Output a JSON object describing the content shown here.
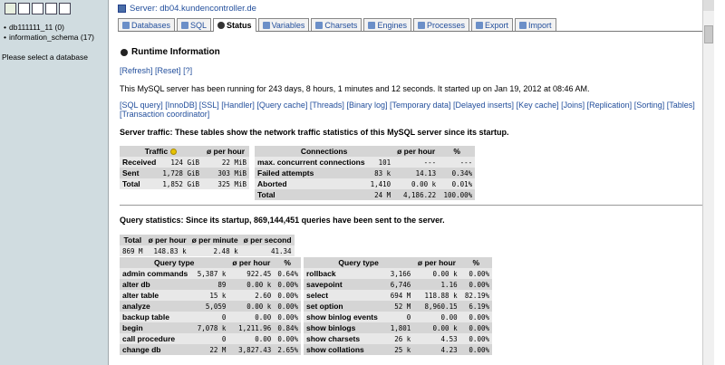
{
  "sidebar": {
    "databases": [
      "db111111_11 (0)",
      "information_schema (17)"
    ],
    "prompt": "Please select a database"
  },
  "header": {
    "server_label": "Server: db04.kundencontroller.de"
  },
  "tabs": [
    "Databases",
    "SQL",
    "Status",
    "Variables",
    "Charsets",
    "Engines",
    "Processes",
    "Export",
    "Import"
  ],
  "active_tab": "Status",
  "title": "Runtime Information",
  "top_links": {
    "refresh": "[Refresh]",
    "reset": "[Reset]",
    "help": "[?]"
  },
  "uptime": "This MySQL server has been running for 243 days, 8 hours, 1 minutes and 12 seconds. It started up on Jan 19, 2012 at 08:46 AM.",
  "sub_links": [
    "[SQL query]",
    "[InnoDB]",
    "[SSL]",
    "[Handler]",
    "[Query cache]",
    "[Threads]",
    "[Binary log]",
    "[Temporary data]",
    "[Delayed inserts]",
    "[Key cache]",
    "[Joins]",
    "[Replication]",
    "[Sorting]",
    "[Tables]",
    "[Transaction coordinator]"
  ],
  "traffic": {
    "heading": "Server traffic: These tables show the network traffic statistics of this MySQL server since its startup.",
    "headers": [
      "Traffic",
      "ø per hour"
    ],
    "rows": [
      [
        "Received",
        "124 GiB",
        "22 MiB"
      ],
      [
        "Sent",
        "1,728 GiB",
        "303 MiB"
      ],
      [
        "Total",
        "1,852 GiB",
        "325 MiB"
      ]
    ]
  },
  "connections": {
    "headers": [
      "Connections",
      "ø per hour",
      "%"
    ],
    "rows": [
      [
        "max. concurrent connections",
        "101",
        "---",
        "---"
      ],
      [
        "Failed attempts",
        "83 k",
        "14.13",
        "0.34%"
      ],
      [
        "Aborted",
        "1,410",
        "0.00 k",
        "0.01%"
      ],
      [
        "Total",
        "24 M",
        "4,186.22",
        "100.00%"
      ]
    ]
  },
  "query_stats": {
    "heading": "Query statistics: Since its startup, 869,144,451 queries have been sent to the server.",
    "headers": [
      "Total",
      "ø per hour",
      "ø per minute",
      "ø per second"
    ],
    "values": [
      "869 M",
      "148.83 k",
      "2.48 k",
      "41.34"
    ]
  },
  "query_left": {
    "headers": [
      "Query type",
      "ø per hour",
      "%"
    ],
    "rows": [
      [
        "admin commands",
        "5,387 k",
        "922.45",
        "0.64%"
      ],
      [
        "alter db",
        "89",
        "0.00 k",
        "0.00%"
      ],
      [
        "alter table",
        "15 k",
        "2.60",
        "0.00%"
      ],
      [
        "analyze",
        "5,059",
        "0.00 k",
        "0.00%"
      ],
      [
        "backup table",
        "0",
        "0.00",
        "0.00%"
      ],
      [
        "begin",
        "7,078 k",
        "1,211.96",
        "0.84%"
      ],
      [
        "call procedure",
        "0",
        "0.00",
        "0.00%"
      ],
      [
        "change db",
        "22 M",
        "3,827.43",
        "2.65%"
      ]
    ]
  },
  "query_right": {
    "headers": [
      "Query type",
      "ø per hour",
      "%"
    ],
    "rows": [
      [
        "rollback",
        "3,166",
        "0.00 k",
        "0.00%"
      ],
      [
        "savepoint",
        "6,746",
        "1.16",
        "0.00%"
      ],
      [
        "select",
        "694 M",
        "118.88 k",
        "82.19%"
      ],
      [
        "set option",
        "52 M",
        "8,960.15",
        "6.19%"
      ],
      [
        "show binlog events",
        "0",
        "0.00",
        "0.00%"
      ],
      [
        "show binlogs",
        "1,801",
        "0.00 k",
        "0.00%"
      ],
      [
        "show charsets",
        "26 k",
        "4.53",
        "0.00%"
      ],
      [
        "show collations",
        "25 k",
        "4.23",
        "0.00%"
      ]
    ]
  }
}
